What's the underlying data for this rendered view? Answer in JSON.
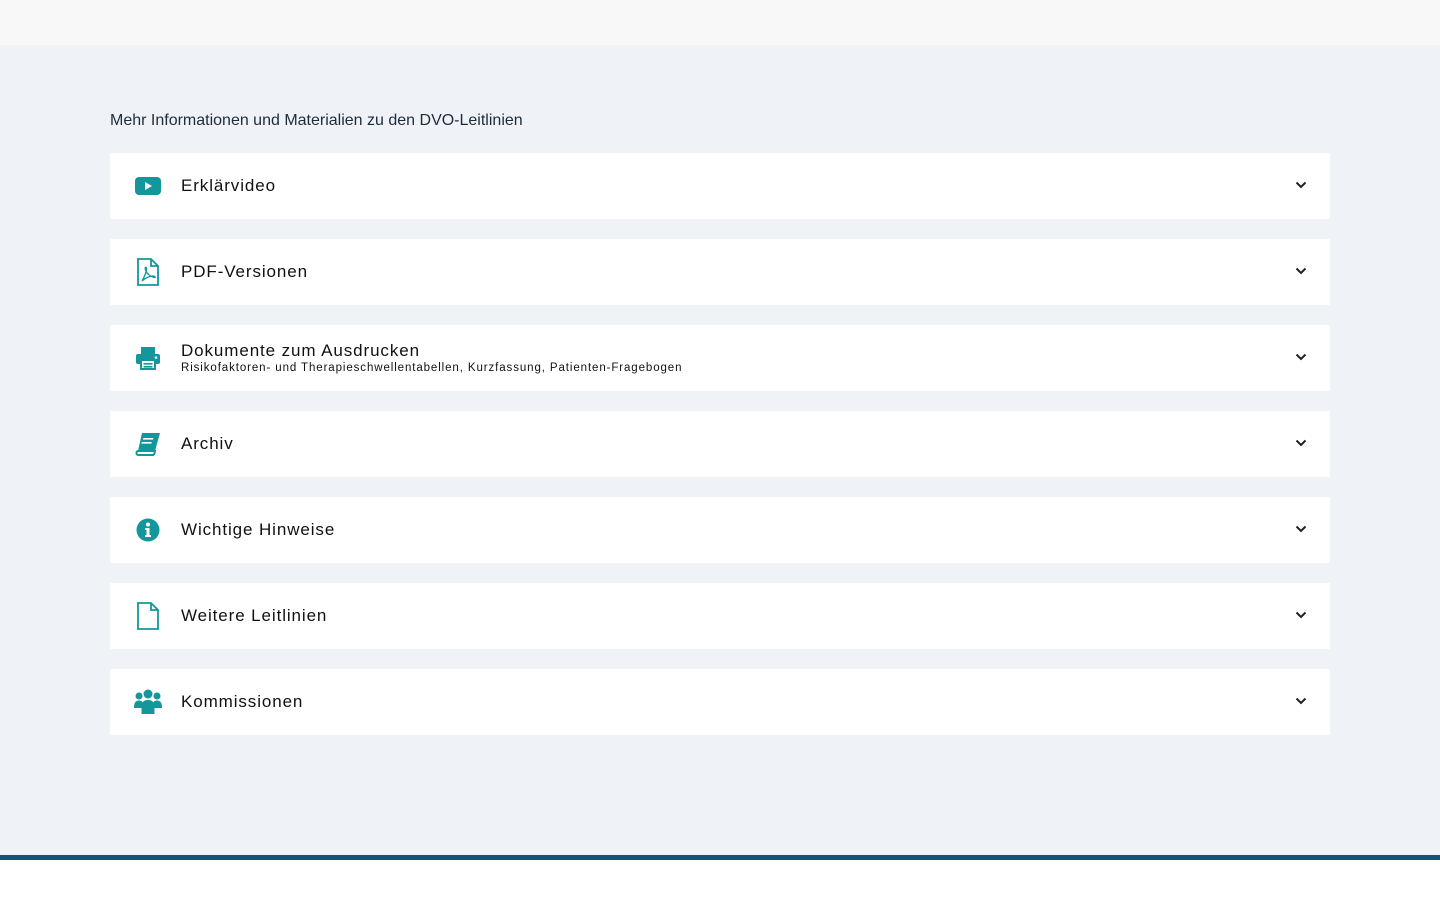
{
  "section": {
    "heading": "Mehr Informationen und Materialien zu den DVO-Leitlinien"
  },
  "accordion": {
    "items": [
      {
        "title": "Erklärvideo",
        "subtitle": "",
        "icon": "video-play-icon"
      },
      {
        "title": "PDF-Versionen",
        "subtitle": "",
        "icon": "pdf-file-icon"
      },
      {
        "title": "Dokumente zum Ausdrucken",
        "subtitle": "Risikofaktoren- und Therapieschwellentabellen, Kurzfassung, Patienten-Fragebogen",
        "icon": "printer-icon"
      },
      {
        "title": "Archiv",
        "subtitle": "",
        "icon": "book-icon"
      },
      {
        "title": "Wichtige Hinweise",
        "subtitle": "",
        "icon": "info-circle-icon"
      },
      {
        "title": "Weitere Leitlinien",
        "subtitle": "",
        "icon": "file-icon"
      },
      {
        "title": "Kommissionen",
        "subtitle": "",
        "icon": "users-icon"
      }
    ]
  },
  "colors": {
    "accent": "#13979b",
    "page_background": "#eff3f8",
    "footer_line": "#1d4f7c"
  }
}
